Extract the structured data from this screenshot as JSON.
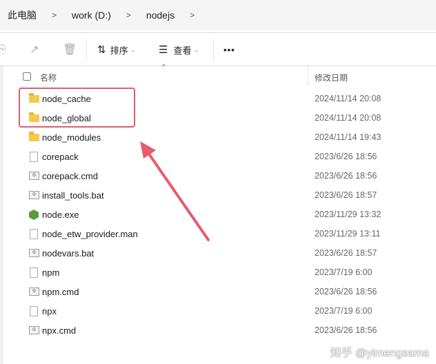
{
  "breadcrumb": [
    "此电脑",
    "work (D:)",
    "nodejs"
  ],
  "toolbar": {
    "sort_label": "排序",
    "view_label": "查看",
    "more_label": "•••"
  },
  "columns": {
    "name": "名称",
    "date": "修改日期"
  },
  "files": [
    {
      "name": "node_cache",
      "date": "2024/11/14 20:08",
      "icon": "folder"
    },
    {
      "name": "node_global",
      "date": "2024/11/14 20:08",
      "icon": "folder"
    },
    {
      "name": "node_modules",
      "date": "2024/11/14 19:43",
      "icon": "folder"
    },
    {
      "name": "corepack",
      "date": "2023/6/26 18:56",
      "icon": "file"
    },
    {
      "name": "corepack.cmd",
      "date": "2023/6/26 18:56",
      "icon": "bat"
    },
    {
      "name": "install_tools.bat",
      "date": "2023/6/26 18:57",
      "icon": "bat"
    },
    {
      "name": "node.exe",
      "date": "2023/11/29 13:32",
      "icon": "exe"
    },
    {
      "name": "node_etw_provider.man",
      "date": "2023/11/29 13:11",
      "icon": "file"
    },
    {
      "name": "nodevars.bat",
      "date": "2023/6/26 18:57",
      "icon": "bat"
    },
    {
      "name": "npm",
      "date": "2023/7/19 6:00",
      "icon": "file"
    },
    {
      "name": "npm.cmd",
      "date": "2023/6/26 18:56",
      "icon": "bat"
    },
    {
      "name": "npx",
      "date": "2023/7/19 6:00",
      "icon": "file"
    },
    {
      "name": "npx.cmd",
      "date": "2023/6/26 18:56",
      "icon": "bat"
    }
  ],
  "watermark": "知乎 @yimengsama",
  "colors": {
    "highlight": "#e25c6c",
    "folder": "#f6c94e"
  }
}
